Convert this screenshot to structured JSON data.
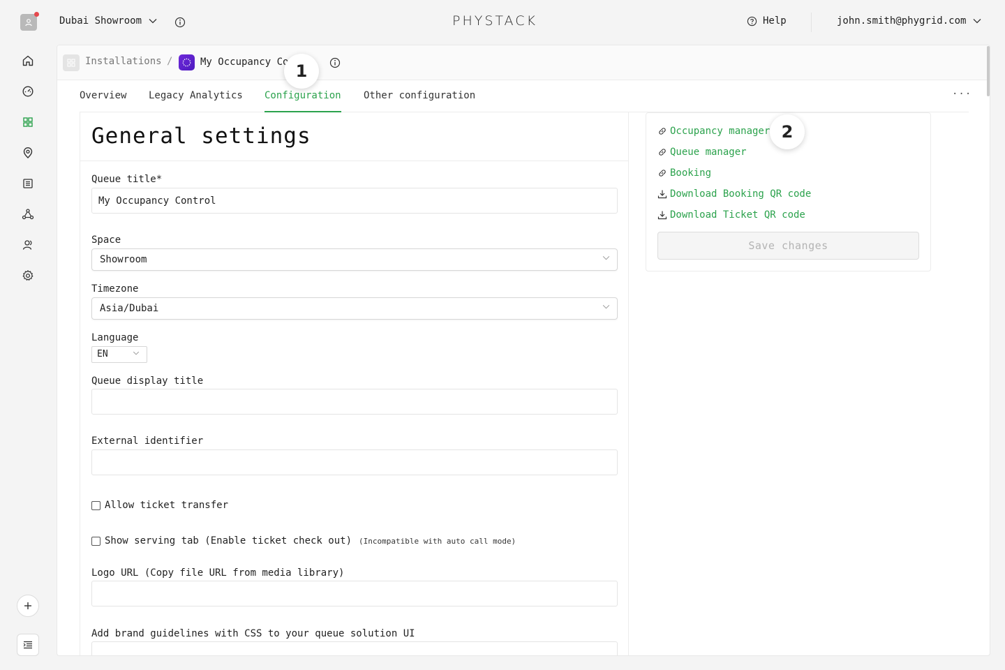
{
  "header": {
    "workspace_name": "Dubai Showroom",
    "logo_text": "PHYSTACK",
    "help_label": "Help",
    "user_email": "john.smith@phygrid.com"
  },
  "nav": {
    "items": [
      {
        "name": "home-icon",
        "active": false
      },
      {
        "name": "dashboard-icon",
        "active": false
      },
      {
        "name": "installations-icon",
        "active": true
      },
      {
        "name": "location-icon",
        "active": false
      },
      {
        "name": "list-icon",
        "active": false
      },
      {
        "name": "network-icon",
        "active": false
      },
      {
        "name": "users-icon",
        "active": false
      },
      {
        "name": "settings-icon",
        "active": false
      }
    ]
  },
  "breadcrumb": {
    "root": "Installations",
    "separator": "/",
    "current": "My Occupancy Co"
  },
  "tabs": [
    {
      "label": "Overview",
      "active": false
    },
    {
      "label": "Legacy Analytics",
      "active": false
    },
    {
      "label": "Configuration",
      "active": true
    },
    {
      "label": "Other configuration",
      "active": false
    }
  ],
  "tabs_more": "···",
  "form": {
    "title": "General settings",
    "queue_title_label": "Queue title*",
    "queue_title_value": "My Occupancy Control",
    "space_label": "Space",
    "space_value": "Showroom",
    "timezone_label": "Timezone",
    "timezone_value": "Asia/Dubai",
    "language_label": "Language",
    "language_value": "EN",
    "queue_display_title_label": "Queue display title",
    "queue_display_title_value": "",
    "external_identifier_label": "External identifier",
    "external_identifier_value": "",
    "allow_transfer_label": "Allow ticket transfer",
    "show_serving_label": "Show serving tab (Enable ticket check out)",
    "show_serving_note": "(Incompatible with auto call mode)",
    "logo_url_label": "Logo URL (Copy file URL from media library)",
    "logo_url_value": "",
    "css_label": "Add brand guidelines with CSS to your queue solution UI"
  },
  "links": [
    {
      "label": "Occupancy manager",
      "icon": "link-icon"
    },
    {
      "label": "Queue manager",
      "icon": "link-icon"
    },
    {
      "label": "Booking",
      "icon": "link-icon"
    },
    {
      "label": "Download Booking QR code",
      "icon": "download-icon"
    },
    {
      "label": "Download Ticket QR code",
      "icon": "download-icon"
    }
  ],
  "save_label": "Save changes",
  "markers": [
    "1",
    "2"
  ],
  "colors": {
    "accent": "#2ba24c",
    "app_icon": "#6d28d9",
    "notification": "#e5484d"
  }
}
